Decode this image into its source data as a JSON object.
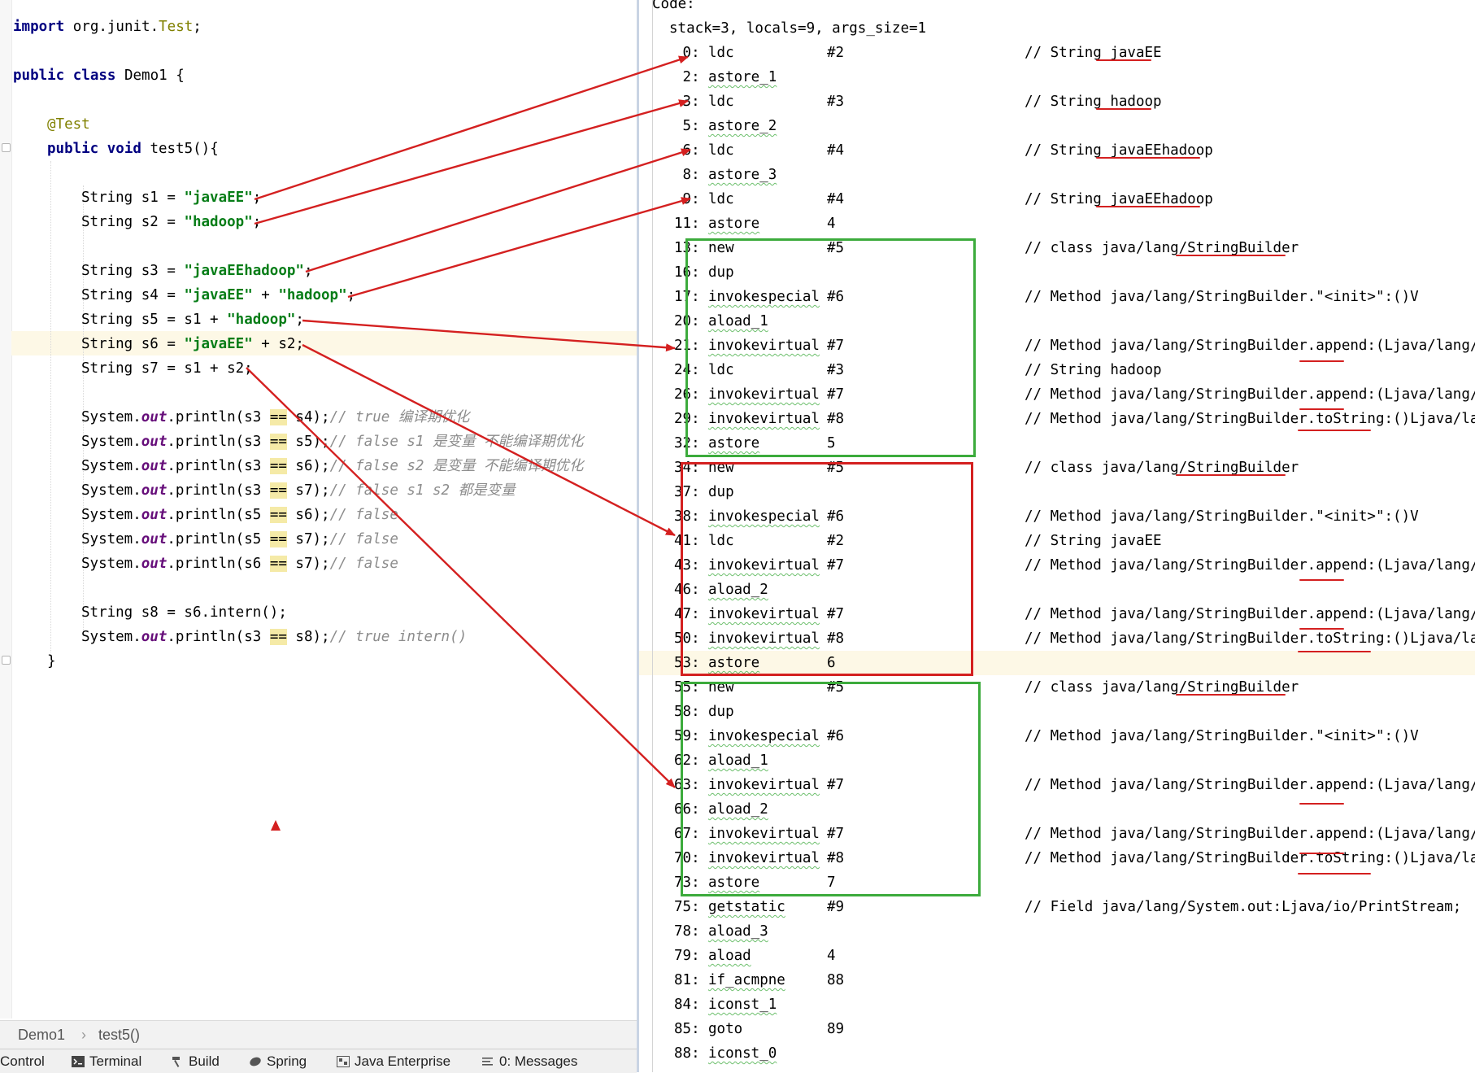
{
  "editor": {
    "lines": {
      "import": [
        "import",
        " org.junit.",
        "Test",
        ";"
      ],
      "class_decl": [
        "public class",
        " Demo1 {"
      ],
      "annotation": "@Test",
      "method_decl": [
        "public void",
        " test5(){"
      ],
      "s1": [
        "String s1 = ",
        "\"javaEE\"",
        ";"
      ],
      "s2": [
        "String s2 = ",
        "\"hadoop\"",
        ";"
      ],
      "s3": [
        "String s3 = ",
        "\"javaEEhadoop\"",
        ";"
      ],
      "s4": [
        "String s4 = ",
        "\"javaEE\"",
        " + ",
        "\"hadoop\"",
        ";"
      ],
      "s5": [
        "String s5 = s1 + ",
        "\"hadoop\"",
        ";"
      ],
      "s6": [
        "String s6 = ",
        "\"javaEE\"",
        " + s2;"
      ],
      "s7": "String s7 = s1 + s2;",
      "p1": [
        "System.",
        "out",
        ".println(s3 ",
        "==",
        " s4);",
        "// true 编译期优化"
      ],
      "p2": [
        "System.",
        "out",
        ".println(s3 ",
        "==",
        " s5);",
        "// false s1 是变量 不能编译期优化"
      ],
      "p3": [
        "System.",
        "out",
        ".println(s3 ",
        "==",
        " s6);",
        "// false s2 是变量 不能编译期优化"
      ],
      "p4": [
        "System.",
        "out",
        ".println(s3 ",
        "==",
        " s7);",
        "// false s1 s2 都是变量"
      ],
      "p5": [
        "System.",
        "out",
        ".println(s5 ",
        "==",
        " s6);",
        "// false"
      ],
      "p6": [
        "System.",
        "out",
        ".println(s5 ",
        "==",
        " s7);",
        "// false"
      ],
      "p7": [
        "System.",
        "out",
        ".println(s6 ",
        "==",
        " s7);",
        "// false"
      ],
      "s8": "String s8 = s6.intern();",
      "p8": [
        "System.",
        "out",
        ".println(s3 ",
        "==",
        " s8);",
        "// true intern()"
      ],
      "close": "}"
    },
    "breadcrumb": {
      "class": "Demo1",
      "sep": "›",
      "method": "test5()"
    },
    "tool_windows": [
      "Control",
      "Terminal",
      "Build",
      "Spring",
      "Java Enterprise",
      "0: Messages"
    ]
  },
  "bytecode": {
    "header": "Code:",
    "stack_line": "stack=3, locals=9, args_size=1",
    "rows": [
      {
        "off": " 0:",
        "op": "ldc",
        "arg": "#2",
        "cmt": "// String javaEE"
      },
      {
        "off": " 2:",
        "op": "astore_1",
        "arg": "",
        "cmt": ""
      },
      {
        "off": " 3:",
        "op": "ldc",
        "arg": "#3",
        "cmt": "// String hadoop"
      },
      {
        "off": " 5:",
        "op": "astore_2",
        "arg": "",
        "cmt": ""
      },
      {
        "off": " 6:",
        "op": "ldc",
        "arg": "#4",
        "cmt": "// String javaEEhadoop"
      },
      {
        "off": " 8:",
        "op": "astore_3",
        "arg": "",
        "cmt": ""
      },
      {
        "off": " 9:",
        "op": "ldc",
        "arg": "#4",
        "cmt": "// String javaEEhadoop"
      },
      {
        "off": "11:",
        "op": "astore",
        "arg": "4",
        "cmt": ""
      },
      {
        "off": "13:",
        "op": "new",
        "arg": "#5",
        "cmt": "// class java/lang/StringBuilder"
      },
      {
        "off": "16:",
        "op": "dup",
        "arg": "",
        "cmt": ""
      },
      {
        "off": "17:",
        "op": "invokespecial",
        "arg": "#6",
        "cmt": "// Method java/lang/StringBuilder.\"<init>\":()V"
      },
      {
        "off": "20:",
        "op": "aload_1",
        "arg": "",
        "cmt": ""
      },
      {
        "off": "21:",
        "op": "invokevirtual",
        "arg": "#7",
        "cmt": "// Method java/lang/StringBuilder.append:(Ljava/lang/S"
      },
      {
        "off": "24:",
        "op": "ldc",
        "arg": "#3",
        "cmt": "// String hadoop"
      },
      {
        "off": "26:",
        "op": "invokevirtual",
        "arg": "#7",
        "cmt": "// Method java/lang/StringBuilder.append:(Ljava/lang/S"
      },
      {
        "off": "29:",
        "op": "invokevirtual",
        "arg": "#8",
        "cmt": "// Method java/lang/StringBuilder.toString:()Ljava/lan"
      },
      {
        "off": "32:",
        "op": "astore",
        "arg": "5",
        "cmt": ""
      },
      {
        "off": "34:",
        "op": "new",
        "arg": "#5",
        "cmt": "// class java/lang/StringBuilder"
      },
      {
        "off": "37:",
        "op": "dup",
        "arg": "",
        "cmt": ""
      },
      {
        "off": "38:",
        "op": "invokespecial",
        "arg": "#6",
        "cmt": "// Method java/lang/StringBuilder.\"<init>\":()V"
      },
      {
        "off": "41:",
        "op": "ldc",
        "arg": "#2",
        "cmt": "// String javaEE"
      },
      {
        "off": "43:",
        "op": "invokevirtual",
        "arg": "#7",
        "cmt": "// Method java/lang/StringBuilder.append:(Ljava/lang/S"
      },
      {
        "off": "46:",
        "op": "aload_2",
        "arg": "",
        "cmt": ""
      },
      {
        "off": "47:",
        "op": "invokevirtual",
        "arg": "#7",
        "cmt": "// Method java/lang/StringBuilder.append:(Ljava/lang/S"
      },
      {
        "off": "50:",
        "op": "invokevirtual",
        "arg": "#8",
        "cmt": "// Method java/lang/StringBuilder.toString:()Ljava/lan"
      },
      {
        "off": "53:",
        "op": "astore",
        "arg": "6",
        "cmt": ""
      },
      {
        "off": "55:",
        "op": "new",
        "arg": "#5",
        "cmt": "// class java/lang/StringBuilder"
      },
      {
        "off": "58:",
        "op": "dup",
        "arg": "",
        "cmt": ""
      },
      {
        "off": "59:",
        "op": "invokespecial",
        "arg": "#6",
        "cmt": "// Method java/lang/StringBuilder.\"<init>\":()V"
      },
      {
        "off": "62:",
        "op": "aload_1",
        "arg": "",
        "cmt": ""
      },
      {
        "off": "63:",
        "op": "invokevirtual",
        "arg": "#7",
        "cmt": "// Method java/lang/StringBuilder.append:(Ljava/lang/S"
      },
      {
        "off": "66:",
        "op": "aload_2",
        "arg": "",
        "cmt": ""
      },
      {
        "off": "67:",
        "op": "invokevirtual",
        "arg": "#7",
        "cmt": "// Method java/lang/StringBuilder.append:(Ljava/lang/S"
      },
      {
        "off": "70:",
        "op": "invokevirtual",
        "arg": "#8",
        "cmt": "// Method java/lang/StringBuilder.toString:()Ljava/lan"
      },
      {
        "off": "73:",
        "op": "astore",
        "arg": "7",
        "cmt": ""
      },
      {
        "off": "75:",
        "op": "getstatic",
        "arg": "#9",
        "cmt": "// Field java/lang/System.out:Ljava/io/PrintStream;"
      },
      {
        "off": "78:",
        "op": "aload_3",
        "arg": "",
        "cmt": ""
      },
      {
        "off": "79:",
        "op": "aload",
        "arg": "4",
        "cmt": ""
      },
      {
        "off": "81:",
        "op": "if_acmpne",
        "arg": "88",
        "cmt": ""
      },
      {
        "off": "84:",
        "op": "iconst_1",
        "arg": "",
        "cmt": ""
      },
      {
        "off": "85:",
        "op": "goto",
        "arg": "89",
        "cmt": ""
      },
      {
        "off": "88:",
        "op": "iconst_0",
        "arg": "",
        "cmt": ""
      }
    ]
  },
  "colors": {
    "arrow": "#d42020",
    "green_box": "#3cab3c",
    "red_box": "#d42020",
    "keyword": "#000080",
    "string": "#067d17",
    "annotation": "#808000",
    "comment": "#8c8c8c",
    "static_field": "#660e7a",
    "line_highlight": "#fdf8e6"
  }
}
